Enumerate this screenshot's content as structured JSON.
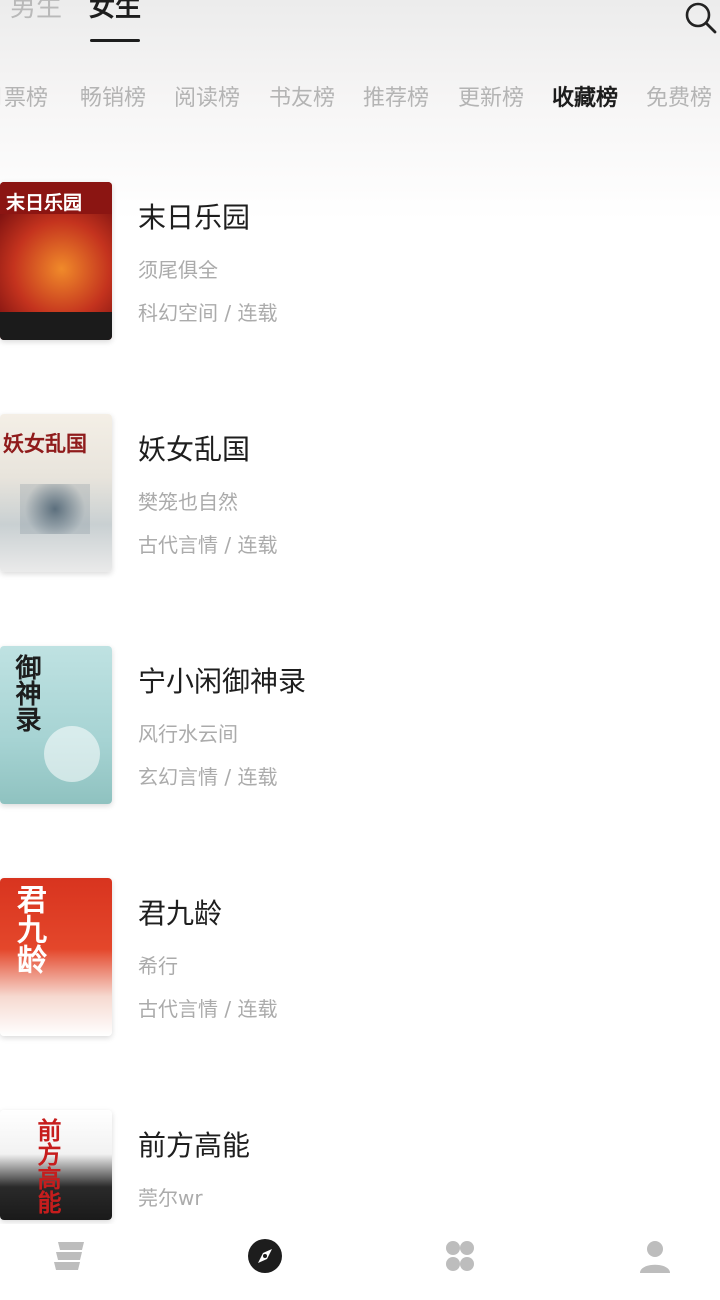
{
  "header": {
    "tabs": [
      {
        "label": "男生",
        "active": false
      },
      {
        "label": "女生",
        "active": true
      }
    ]
  },
  "rank_tabs": [
    {
      "label": "月票榜",
      "active": false
    },
    {
      "label": "畅销榜",
      "active": false
    },
    {
      "label": "阅读榜",
      "active": false
    },
    {
      "label": "书友榜",
      "active": false
    },
    {
      "label": "推荐榜",
      "active": false
    },
    {
      "label": "更新榜",
      "active": false
    },
    {
      "label": "收藏榜",
      "active": true
    },
    {
      "label": "免费榜",
      "active": false
    }
  ],
  "books": [
    {
      "title": "末日乐园",
      "author": "须尾俱全",
      "meta": "科幻空间 / 连载",
      "cover_text": "末日乐园"
    },
    {
      "title": "妖女乱国",
      "author": "樊笼也自然",
      "meta": "古代言情 / 连载",
      "cover_text": "妖女乱国"
    },
    {
      "title": "宁小闲御神录",
      "author": "风行水云间",
      "meta": "玄幻言情 / 连载",
      "cover_text": "御神录"
    },
    {
      "title": "君九龄",
      "author": "希行",
      "meta": "古代言情 / 连载",
      "cover_text": "君九龄"
    },
    {
      "title": "前方高能",
      "author": "莞尔wr",
      "meta": "",
      "cover_text": "前方高能"
    }
  ],
  "bottom_nav": [
    {
      "icon": "bookshelf-icon",
      "active": false
    },
    {
      "icon": "compass-icon",
      "active": true
    },
    {
      "icon": "category-icon",
      "active": false
    },
    {
      "icon": "profile-icon",
      "active": false
    }
  ],
  "colors": {
    "active_text": "#1d1d1d",
    "inactive_text": "#b4b4b4",
    "secondary_text": "#ababab"
  }
}
